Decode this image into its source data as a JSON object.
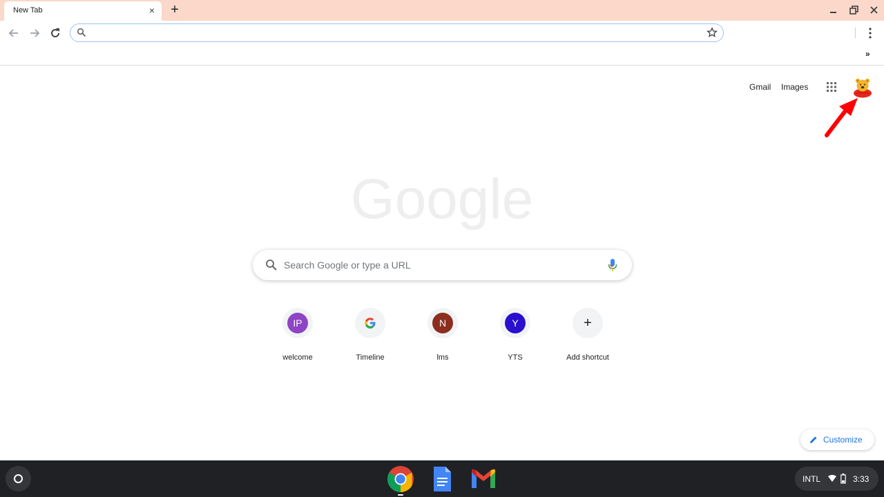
{
  "browser": {
    "tab_title": "New Tab",
    "tab_close": "×",
    "new_tab": "+",
    "omnibox_value": "",
    "omnibox_placeholder": "",
    "more_bookmarks": "»"
  },
  "newtab": {
    "links": {
      "gmail": "Gmail",
      "images": "Images"
    },
    "logo_text": "Google",
    "search_placeholder": "Search Google or type a URL",
    "shortcuts": [
      {
        "letter": "IP",
        "label": "welcome",
        "color": "#8e44c5"
      },
      {
        "letter": "G",
        "label": "Timeline",
        "color": "google"
      },
      {
        "letter": "N",
        "label": "lms",
        "color": "#8b2e1e"
      },
      {
        "letter": "Y",
        "label": "YTS",
        "color": "#2a0fcf"
      },
      {
        "letter": "+",
        "label": "Add shortcut",
        "color": "#f1f3f4"
      }
    ],
    "customize_label": "Customize"
  },
  "shelf": {
    "apps": [
      "chrome-icon",
      "docs-icon",
      "gmail-icon"
    ],
    "input_method": "INTL",
    "time": "3:33"
  },
  "colors": {
    "tabstrip": "#fbd8c9",
    "accent_blue": "#1a73e8",
    "shelf": "#202124",
    "arrow": "#ff0000"
  }
}
